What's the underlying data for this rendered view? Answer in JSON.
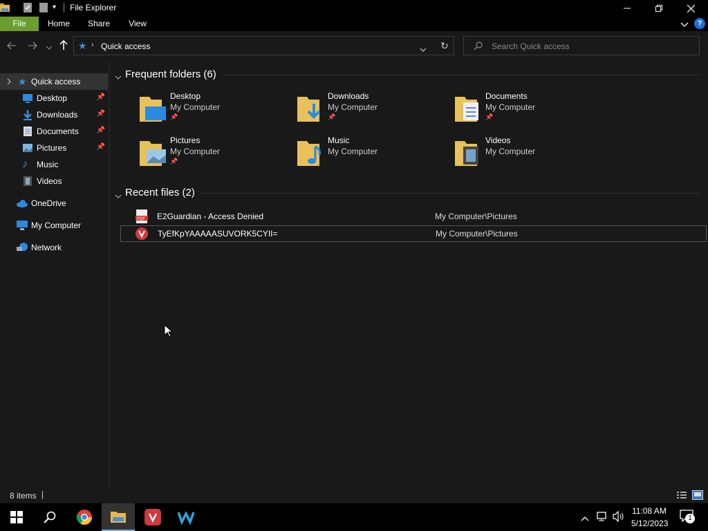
{
  "window": {
    "title": "File Explorer"
  },
  "ribbon": {
    "tabs": [
      "File",
      "Home",
      "Share",
      "View"
    ]
  },
  "address": {
    "path": "Quick access",
    "search_placeholder": "Search Quick access"
  },
  "sidebar": {
    "quick_access": "Quick access",
    "items": [
      {
        "label": "Desktop",
        "pinned": true
      },
      {
        "label": "Downloads",
        "pinned": true
      },
      {
        "label": "Documents",
        "pinned": true
      },
      {
        "label": "Pictures",
        "pinned": true
      },
      {
        "label": "Music",
        "pinned": false
      },
      {
        "label": "Videos",
        "pinned": false
      }
    ],
    "onedrive": "OneDrive",
    "my_computer": "My Computer",
    "network": "Network"
  },
  "frequent": {
    "header": "Frequent folders (6)",
    "folders": [
      {
        "name": "Desktop",
        "location": "My Computer",
        "pinned": true
      },
      {
        "name": "Downloads",
        "location": "My Computer",
        "pinned": true
      },
      {
        "name": "Documents",
        "location": "My Computer",
        "pinned": true
      },
      {
        "name": "Pictures",
        "location": "My Computer",
        "pinned": true
      },
      {
        "name": "Music",
        "location": "My Computer",
        "pinned": false
      },
      {
        "name": "Videos",
        "location": "My Computer",
        "pinned": false
      }
    ]
  },
  "recent": {
    "header": "Recent files (2)",
    "files": [
      {
        "name": "E2Guardian - Access Denied",
        "path": "My Computer\\Pictures",
        "icon": "pdf-icon"
      },
      {
        "name": "TyEfKpYAAAAASUVORK5CYII=",
        "path": "My Computer\\Pictures",
        "icon": "vivaldi-icon"
      }
    ]
  },
  "status": {
    "item_count": "8 items"
  },
  "taskbar": {
    "time": "11:08 AM",
    "date": "5/12/2023",
    "notification_count": "1"
  },
  "colors": {
    "accent_file_tab": "#6a9f2f",
    "selection": "#333333",
    "help": "#1e6fd9"
  }
}
